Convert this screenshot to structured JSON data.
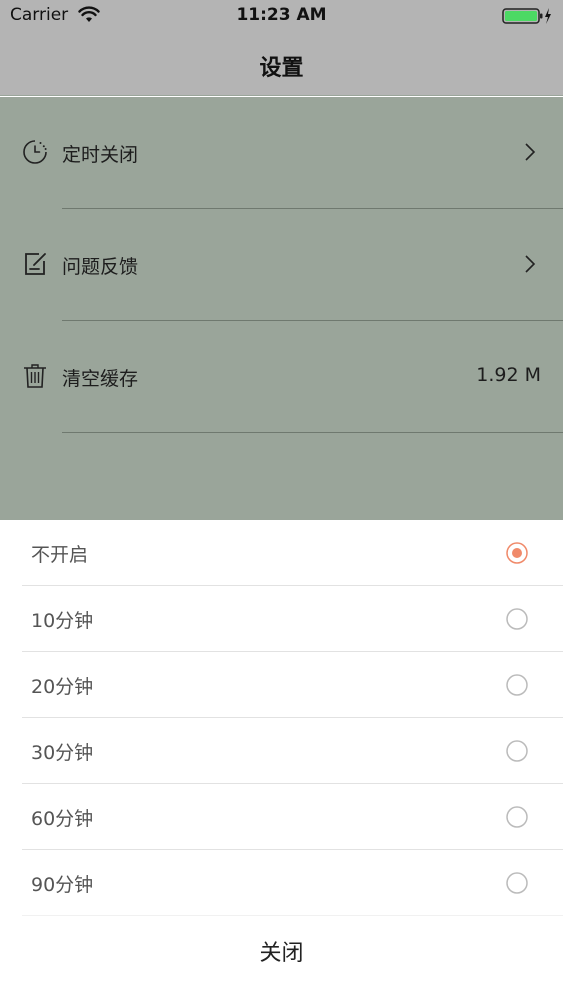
{
  "status_bar": {
    "carrier": "Carrier",
    "time": "11:23 AM"
  },
  "nav": {
    "title": "设置"
  },
  "settings": {
    "items": [
      {
        "label": "定时关闭",
        "icon": "clock-icon",
        "accessory": "chevron"
      },
      {
        "label": "问题反馈",
        "icon": "feedback-icon",
        "accessory": "chevron"
      },
      {
        "label": "清空缓存",
        "icon": "trash-icon",
        "value": "1.92 M"
      }
    ]
  },
  "sheet": {
    "options": [
      {
        "label": "不开启",
        "selected": true
      },
      {
        "label": "10分钟",
        "selected": false
      },
      {
        "label": "20分钟",
        "selected": false
      },
      {
        "label": "30分钟",
        "selected": false
      },
      {
        "label": "60分钟",
        "selected": false
      },
      {
        "label": "90分钟",
        "selected": false
      }
    ],
    "close_label": "关闭"
  },
  "colors": {
    "accent": "#f08a6a",
    "overlay": "#9aa59a",
    "battery": "#4cd964"
  }
}
